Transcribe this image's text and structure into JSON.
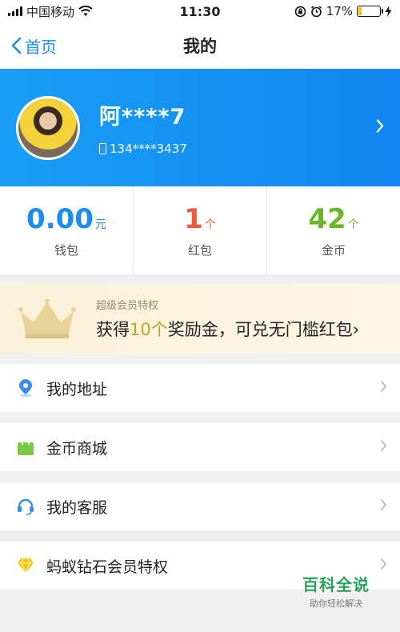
{
  "status_bar": {
    "carrier": "中国移动",
    "time": "11:30",
    "battery_text": "17%",
    "battery_level": 0.17,
    "icons": [
      "signal-icon",
      "wifi-icon",
      "rotation-lock-icon",
      "alarm-icon",
      "battery-icon",
      "charging-icon"
    ]
  },
  "nav": {
    "back_label": "首页",
    "title": "我的"
  },
  "profile": {
    "name": "阿****7",
    "phone": "134****3437"
  },
  "stats": [
    {
      "value": "0.00",
      "unit": "元",
      "label": "钱包",
      "color": "#1a8cf5"
    },
    {
      "value": "1",
      "unit": "个",
      "label": "红包",
      "color": "#f05a3c"
    },
    {
      "value": "42",
      "unit": "个",
      "label": "金币",
      "color": "#6ab82a"
    }
  ],
  "vip": {
    "subtitle": "超级会员特权",
    "text_before": "获得",
    "highlight": "10个",
    "text_after": "奖励金，可兑无门槛红包",
    "chevron": "›"
  },
  "menu": [
    {
      "label": "我的地址",
      "icon": "location-pin-icon",
      "color": "#3a8ee6"
    },
    {
      "label": "金币商城",
      "icon": "shopping-bag-icon",
      "color": "#7ac943"
    },
    {
      "label": "我的客服",
      "icon": "headset-icon",
      "color": "#3a8ee6"
    },
    {
      "label": "蚂蚁钻石会员特权",
      "icon": "diamond-icon",
      "color": "#f5c518"
    }
  ],
  "watermark": {
    "title": "百科全说",
    "subtitle": "助你轻松解决"
  }
}
